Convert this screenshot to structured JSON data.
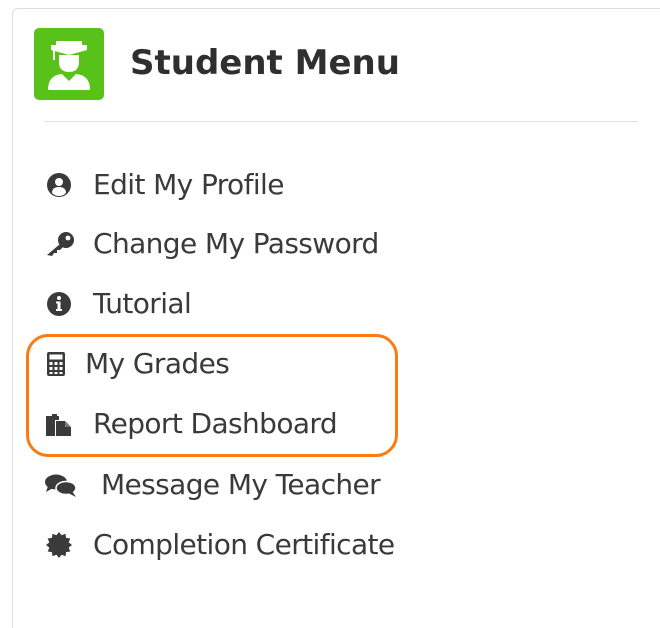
{
  "header": {
    "title": "Student Menu",
    "logo_icon": "student-graduate-icon",
    "logo_color": "#59c21a"
  },
  "menu": {
    "items": [
      {
        "label": "Edit My Profile",
        "icon": "user-circle-icon"
      },
      {
        "label": "Change My Password",
        "icon": "key-icon"
      },
      {
        "label": "Tutorial",
        "icon": "info-circle-icon"
      },
      {
        "label": "My Grades",
        "icon": "calculator-icon"
      },
      {
        "label": "Report Dashboard",
        "icon": "clipboard-icon"
      },
      {
        "label": "Message My Teacher",
        "icon": "chat-bubbles-icon"
      },
      {
        "label": "Completion Certificate",
        "icon": "certificate-badge-icon"
      }
    ]
  },
  "highlight": {
    "color": "#ff7a12",
    "covers": [
      "My Grades",
      "Report Dashboard"
    ]
  }
}
